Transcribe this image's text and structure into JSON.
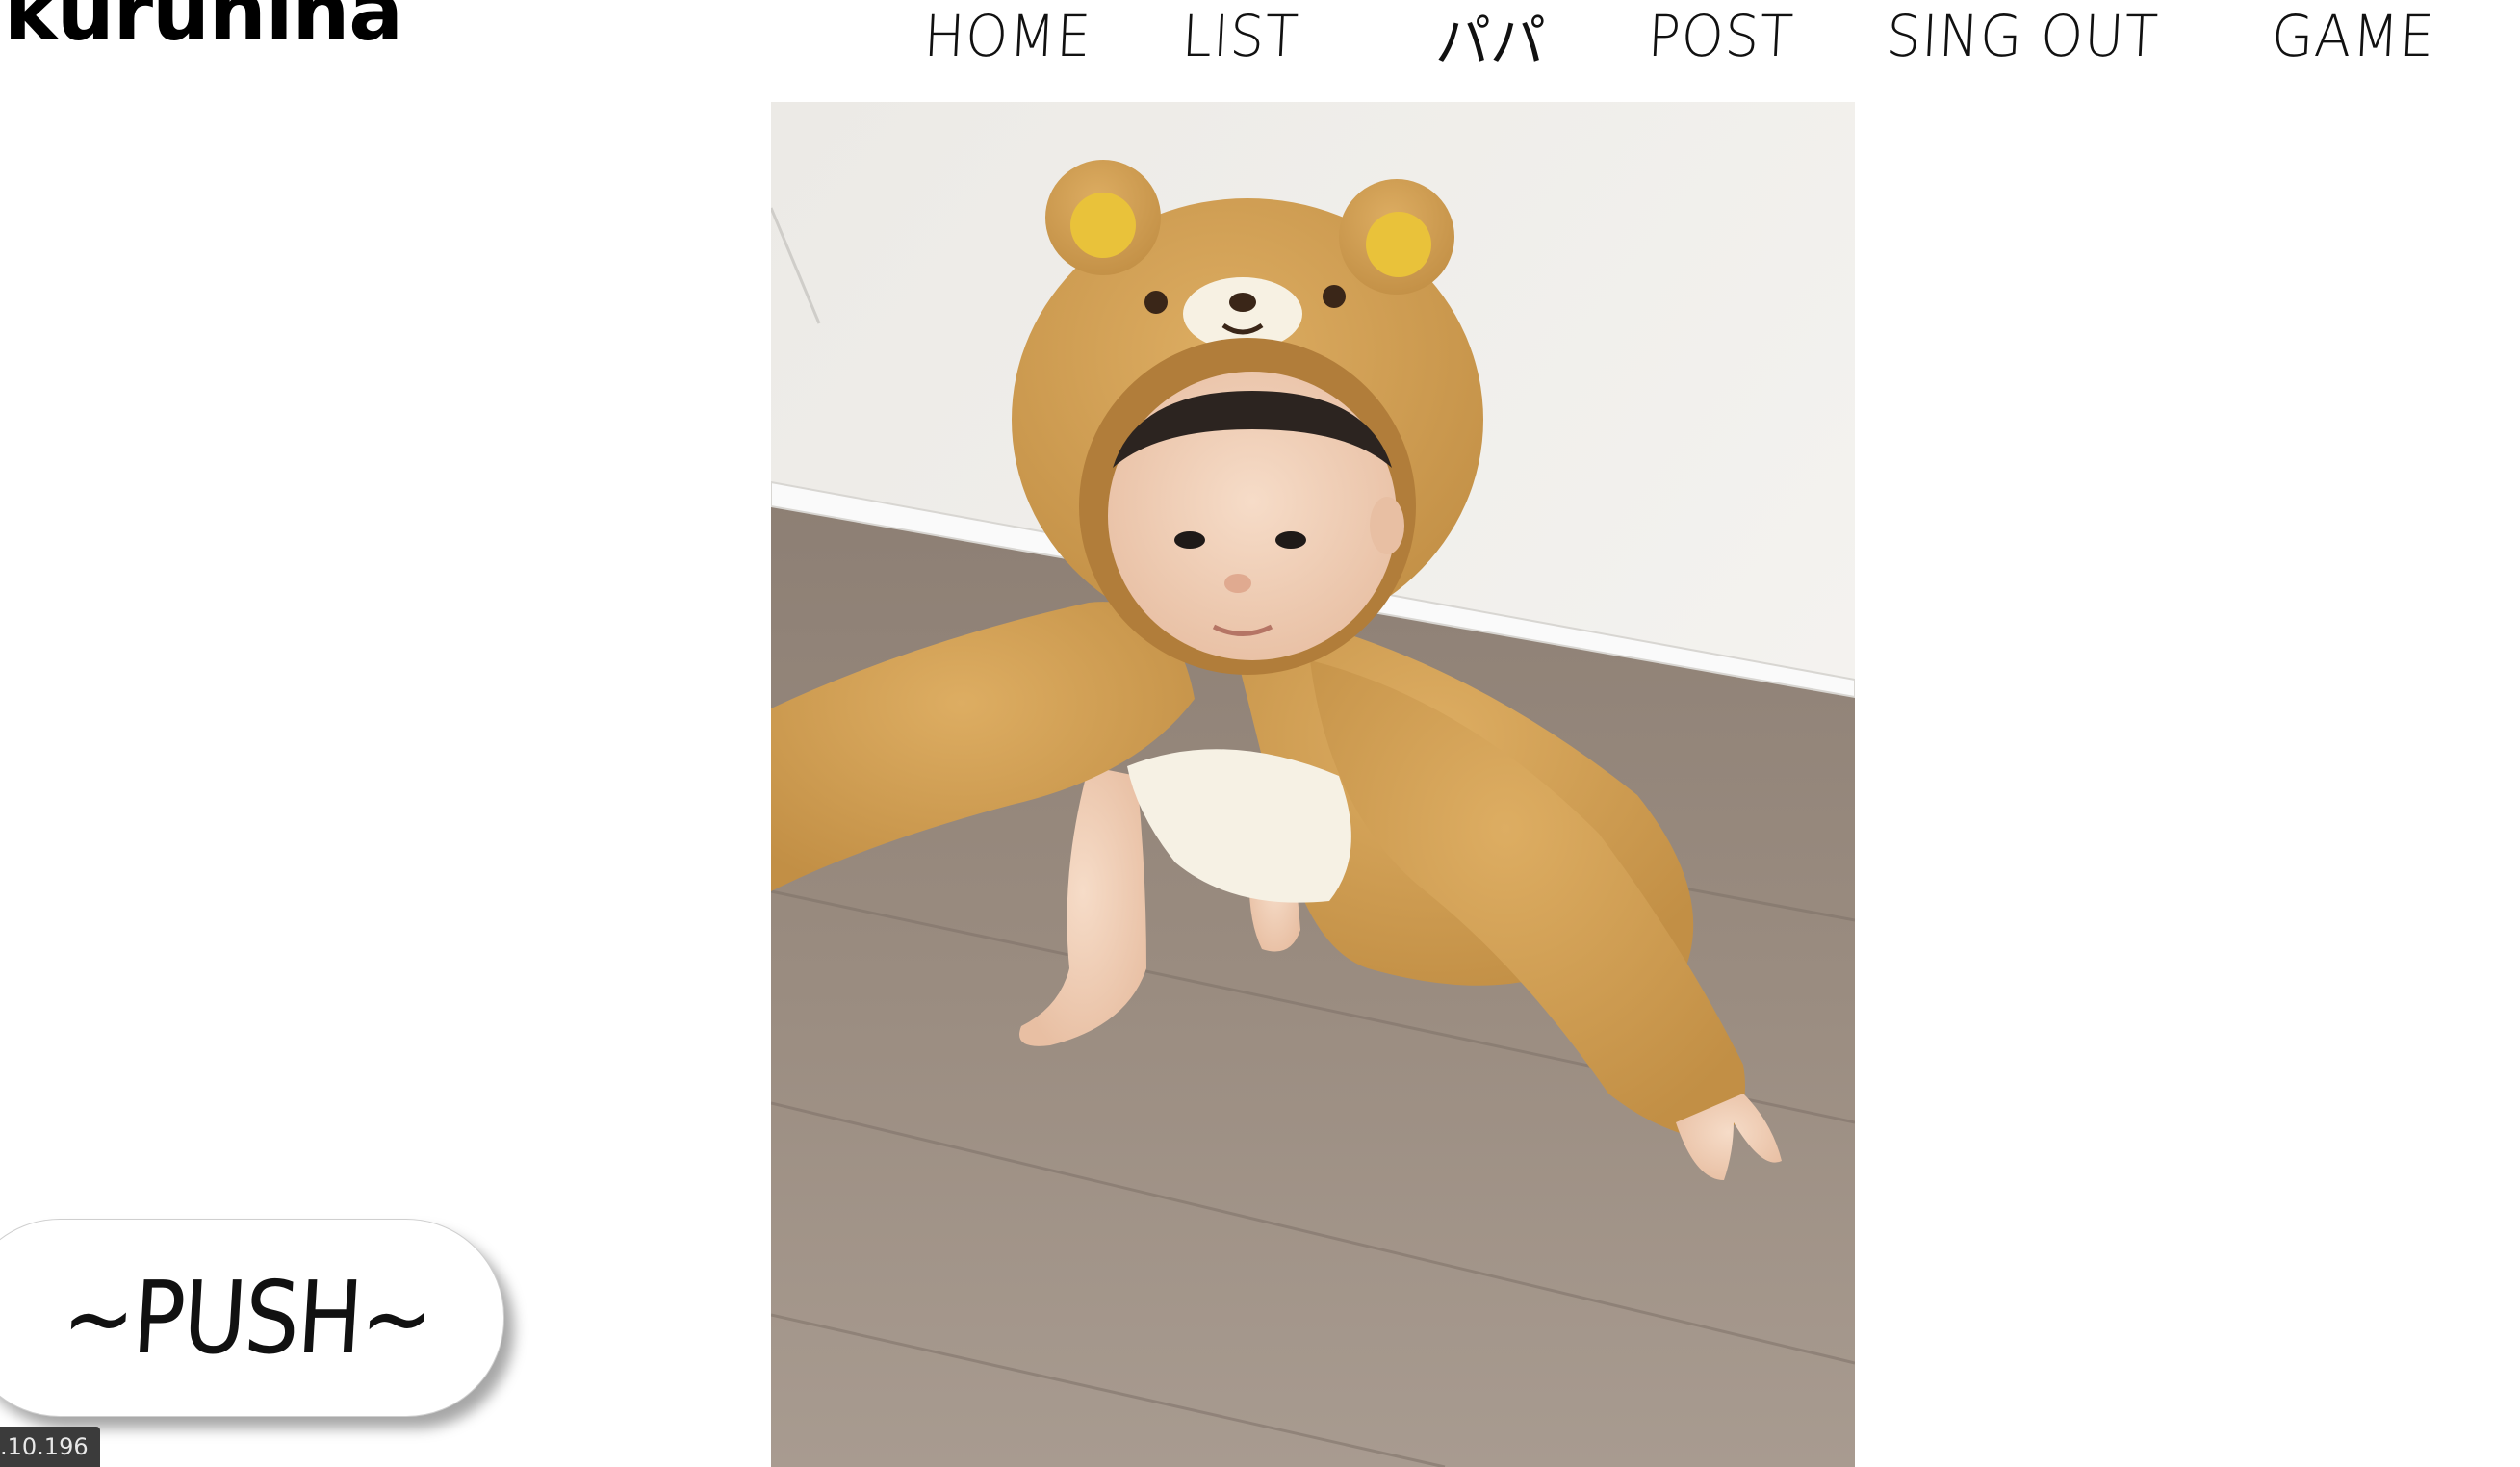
{
  "header": {
    "logo": "kuruhina",
    "nav": [
      {
        "label": "HOME"
      },
      {
        "label": "LIST"
      },
      {
        "label": "パパ"
      },
      {
        "label": "POST"
      },
      {
        "label": "SING OUT"
      },
      {
        "label": "GAME"
      }
    ]
  },
  "main": {
    "photo_icon": "photo-image"
  },
  "push_button": {
    "label": "~PUSH~"
  },
  "status": {
    "text": ".10.196"
  }
}
